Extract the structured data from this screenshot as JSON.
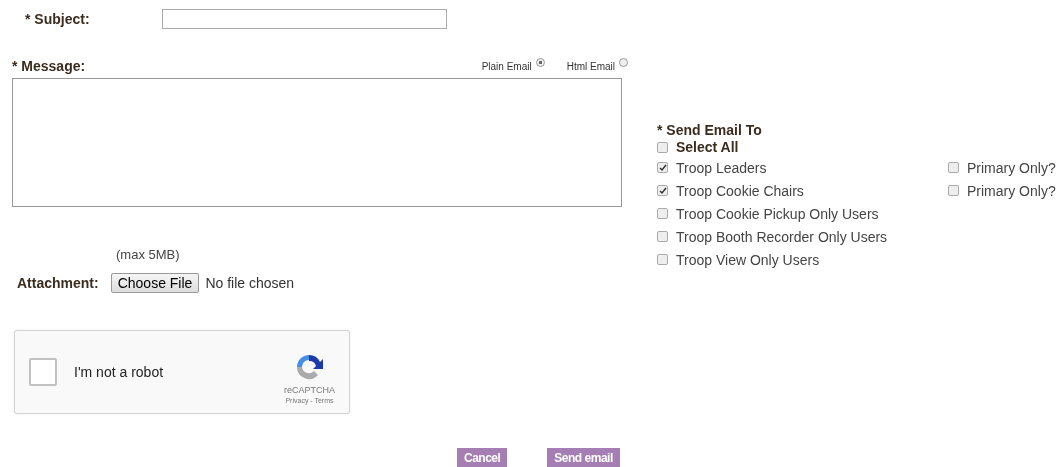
{
  "subject": {
    "label": "* Subject:"
  },
  "message": {
    "label": "* Message:",
    "formats": [
      {
        "label": "Plain Email",
        "selected": true
      },
      {
        "label": "Html Email",
        "selected": false
      }
    ]
  },
  "attachment": {
    "hint": "(max 5MB)",
    "label": "Attachment:",
    "button": "Choose File",
    "status": "No file chosen"
  },
  "captcha": {
    "label": "I'm not a robot",
    "checked": false,
    "brand": "reCAPTCHA",
    "links": "Privacy - Terms"
  },
  "send_to": {
    "title": "* Send Email To",
    "select_all": {
      "label": "Select All",
      "checked": false
    },
    "recipients": [
      {
        "label": "Troop Leaders",
        "checked": true,
        "primary_only": {
          "label": "Primary Only?",
          "checked": false
        }
      },
      {
        "label": "Troop Cookie Chairs",
        "checked": true,
        "primary_only": {
          "label": "Primary Only?",
          "checked": false
        }
      },
      {
        "label": "Troop Cookie Pickup Only Users",
        "checked": false
      },
      {
        "label": "Troop Booth Recorder Only Users",
        "checked": false
      },
      {
        "label": "Troop View Only Users",
        "checked": false
      }
    ]
  },
  "buttons": [
    "Cancel",
    "Send email"
  ]
}
